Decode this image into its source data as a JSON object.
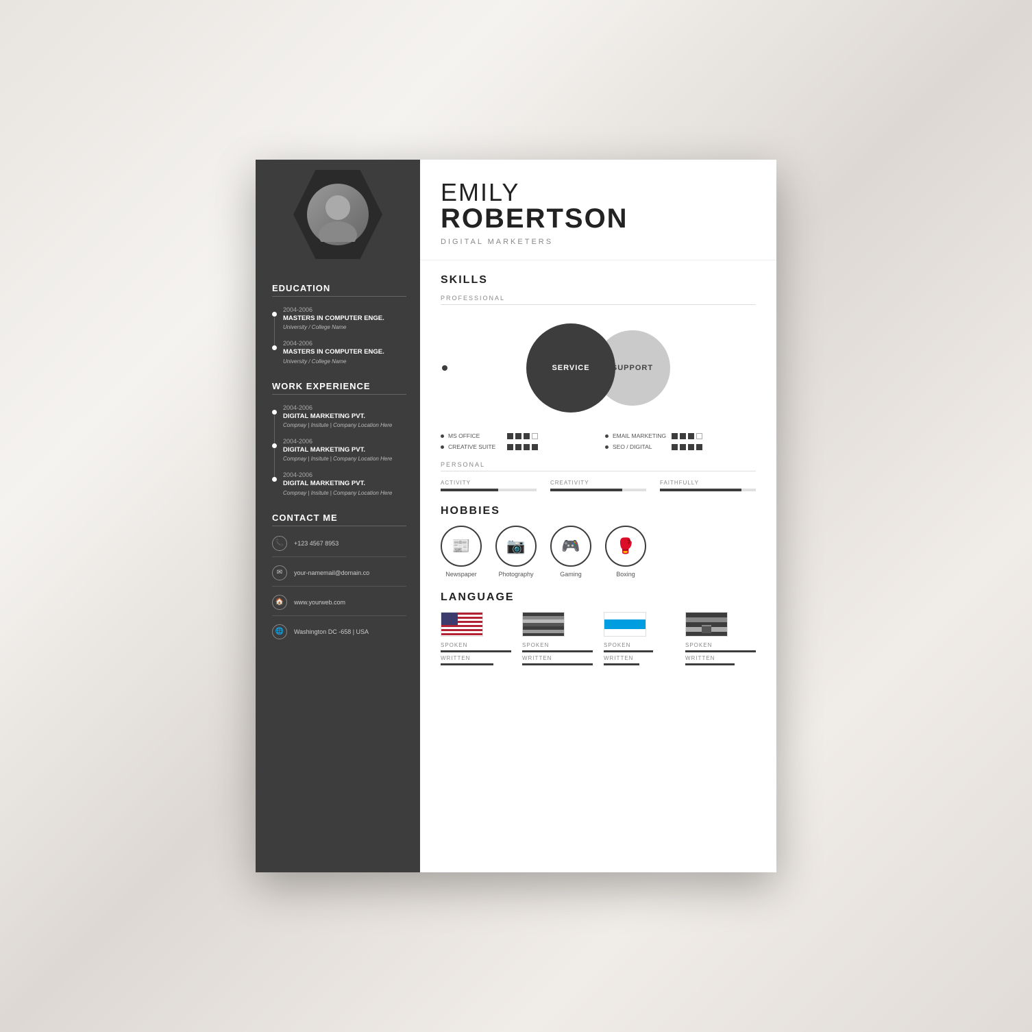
{
  "header": {
    "name_first": "EMILY",
    "name_last": "ROBERTSON",
    "job_title": "DIGITAL MARKETERS"
  },
  "sidebar": {
    "education_title": "EDUCATION",
    "education_items": [
      {
        "year": "2004-2006",
        "degree": "MASTERS IN COMPUTER ENGE.",
        "school": "University / College Name"
      },
      {
        "year": "2004-2006",
        "degree": "MASTERS IN COMPUTER ENGE.",
        "school": "University / College Name"
      }
    ],
    "experience_title": "WORK EXPERIENCE",
    "experience_items": [
      {
        "year": "2004-2006",
        "title": "DIGITAL MARKETING PVT.",
        "company": "Compnay | Insitute | Company Location Here"
      },
      {
        "year": "2004-2006",
        "title": "DIGITAL MARKETING PVT.",
        "company": "Compnay | Insitute | Company Location Here"
      },
      {
        "year": "2004-2006",
        "title": "DIGITAL MARKETING PVT.",
        "company": "Compnay | Insitute | Company Location Here"
      }
    ],
    "contact_title": "CONTACT ME",
    "contact_items": [
      {
        "icon": "📞",
        "text": "+123 4567 8953"
      },
      {
        "icon": "✉",
        "text": "your-namemail@domain.co"
      },
      {
        "icon": "🏠",
        "text": "www.yourweb.com"
      },
      {
        "icon": "🌐",
        "text": "Washington DC -658 | USA"
      }
    ]
  },
  "skills": {
    "title": "SKILLS",
    "professional_label": "PROFESSIONAL",
    "circle1_label": "SERVICE",
    "circle2_label": "SUPPORT",
    "skill_rows": [
      {
        "name": "MS OFFICE",
        "filled": 3,
        "empty": 1
      },
      {
        "name": "EMAIL MARKETING",
        "filled": 3,
        "empty": 1
      },
      {
        "name": "CREATIVE SUITE",
        "filled": 4,
        "empty": 0
      },
      {
        "name": "SEO / DIGITAL",
        "filled": 4,
        "empty": 0
      }
    ],
    "personal_label": "PERSONAL",
    "personal_bars": [
      {
        "label": "ACTIVITY",
        "pct": 60
      },
      {
        "label": "CREATIVITY",
        "pct": 75
      },
      {
        "label": "FAITHFULLY",
        "pct": 85
      }
    ]
  },
  "hobbies": {
    "title": "HOBBIES",
    "items": [
      {
        "icon": "📰",
        "label": "Newspaper"
      },
      {
        "icon": "📷",
        "label": "Photography"
      },
      {
        "icon": "🎮",
        "label": "Gaming"
      },
      {
        "icon": "🥊",
        "label": "Boxing"
      }
    ]
  },
  "language": {
    "title": "LANGUAGE",
    "items": [
      {
        "spoken": "SPOKEN",
        "written": "WRITTEN",
        "bar_spoken": "full",
        "bar_written": "medium"
      },
      {
        "spoken": "SPOKEN",
        "written": "WRITTEN",
        "bar_spoken": "full",
        "bar_written": "full"
      },
      {
        "spoken": "SPOKEN",
        "written": "WRITTEN",
        "bar_spoken": "medium",
        "bar_written": "short"
      },
      {
        "spoken": "SPOKEN",
        "written": "WRITTEN",
        "bar_spoken": "full",
        "bar_written": "medium"
      }
    ]
  }
}
